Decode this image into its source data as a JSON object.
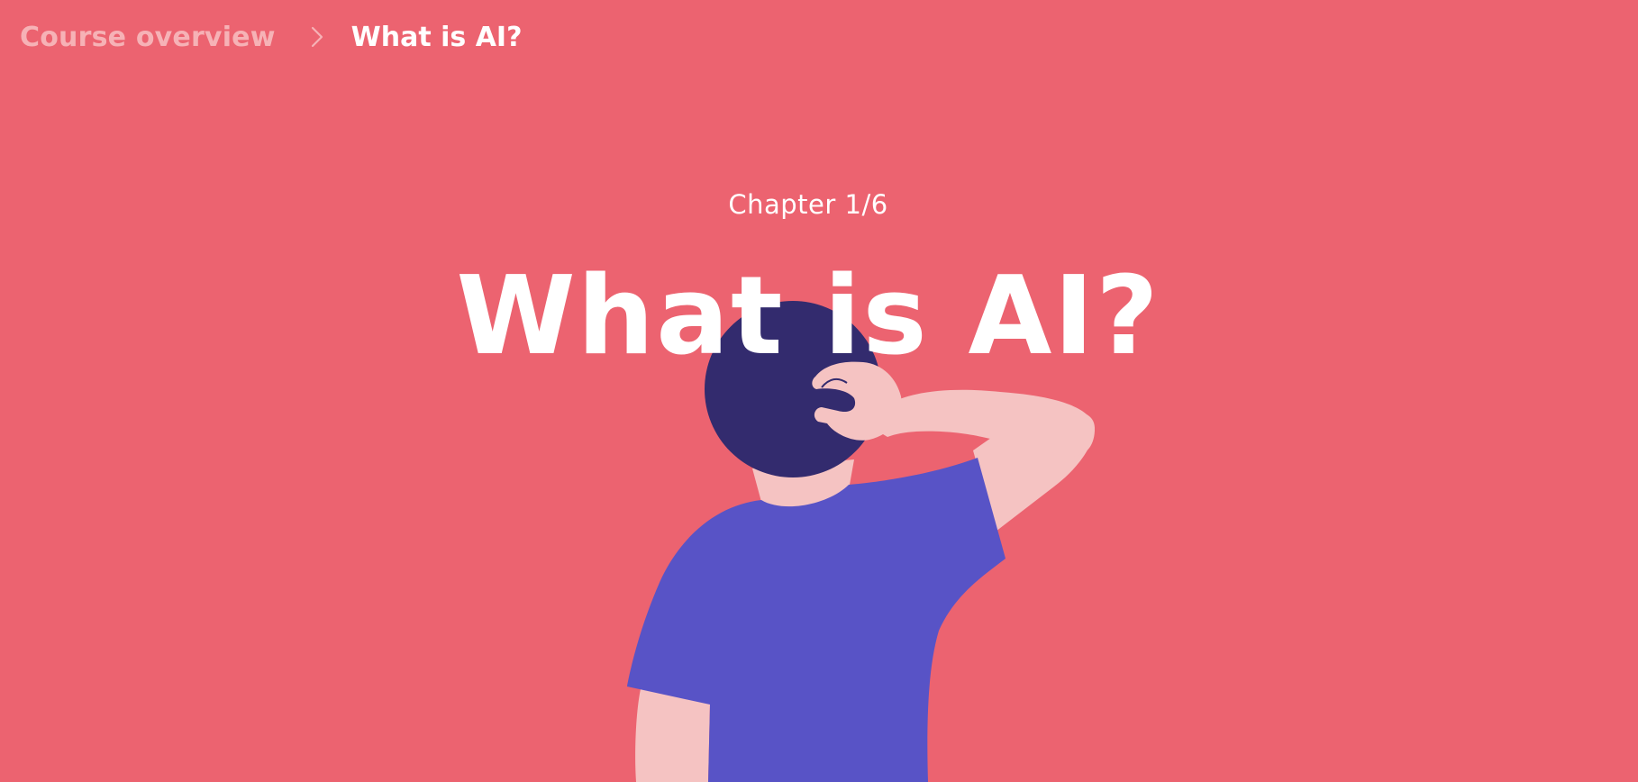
{
  "breadcrumb": {
    "parent_label": "Course overview",
    "current_label": "What is AI?",
    "separator_icon": "chevron-right-icon"
  },
  "chapter": {
    "label": "Chapter 1/6"
  },
  "title": "What is AI?",
  "colors": {
    "background": "#ec6370",
    "breadcrumb_parent": "#f6b2b6",
    "text": "#ffffff",
    "hair": "#332b6e",
    "shirt": "#5853c6",
    "skin": "#f5c3c2"
  },
  "illustration": {
    "subject": "person-scratching-head"
  }
}
